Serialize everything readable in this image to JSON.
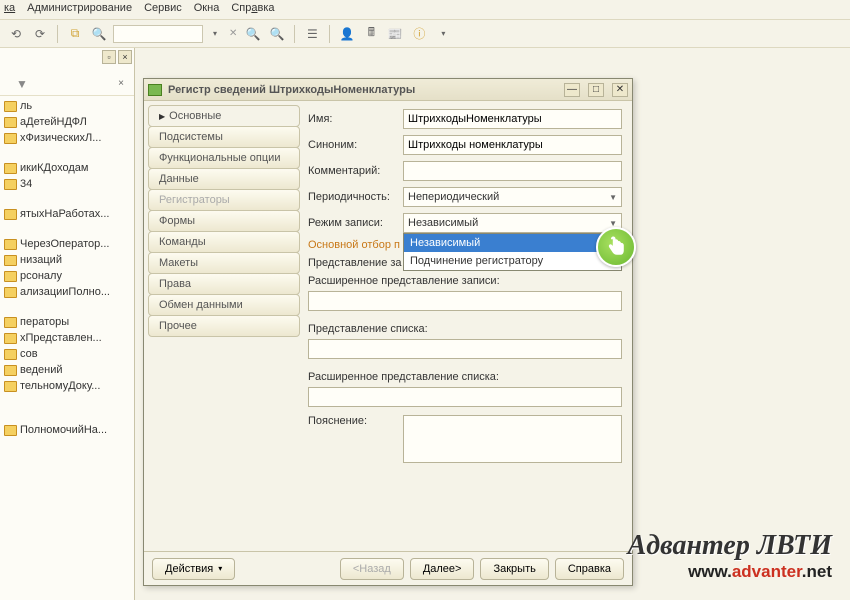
{
  "menu": [
    "ка",
    "Администрирование",
    "Сервис",
    "Окна",
    "Справка"
  ],
  "menu_underline_idx": [
    0,
    0,
    0,
    0,
    3
  ],
  "tree": {
    "items": [
      "ль",
      "аДетейНДФЛ",
      "хФизическихЛ...",
      "",
      "икиКДоходам",
      "34",
      "",
      "ятыхНаРаботах...",
      "",
      "ЧерезОператор...",
      "низаций",
      "рсоналу",
      "ализацииПолно...",
      "",
      "ператоры",
      "хПредставлен...",
      "сов",
      "ведений",
      "тельномуДоку...",
      "",
      "",
      "ПолномочийНа..."
    ]
  },
  "dialog": {
    "title": "Регистр сведений ШтрихкодыНоменклатуры",
    "tabs": [
      {
        "label": "Основные",
        "active": true
      },
      {
        "label": "Подсистемы"
      },
      {
        "label": "Функциональные опции"
      },
      {
        "label": "Данные"
      },
      {
        "label": "Регистраторы",
        "disabled": true
      },
      {
        "label": "Формы"
      },
      {
        "label": "Команды"
      },
      {
        "label": "Макеты"
      },
      {
        "label": "Права"
      },
      {
        "label": "Обмен данными"
      },
      {
        "label": "Прочее"
      }
    ],
    "fields": {
      "name_label": "Имя:",
      "name_value": "ШтрихкодыНоменклатуры",
      "synonym_label": "Синоним:",
      "synonym_value": "Штрихкоды номенклатуры",
      "comment_label": "Комментарий:",
      "comment_value": "",
      "period_label": "Периодичность:",
      "period_value": "Непериодический",
      "mode_label": "Режим записи:",
      "mode_value": "Независимый",
      "mode_options": [
        "Независимый",
        "Подчинение регистратору"
      ],
      "mainfilter_label": "Основной отбор п",
      "recpres_label": "Представление за",
      "extrecpres_label": "Расширенное представление записи:",
      "listpres_label": "Представление списка:",
      "extlistpres_label": "Расширенное представление списка:",
      "explain_label": "Пояснение:"
    },
    "footer": {
      "actions": "Действия",
      "back": "<Назад",
      "next": "Далее>",
      "close": "Закрыть",
      "help": "Справка"
    }
  },
  "watermark": {
    "line1": "Адвантер ЛВТИ",
    "line2_pre": "www.",
    "line2_mid": "advanter",
    "line2_post": ".net"
  }
}
